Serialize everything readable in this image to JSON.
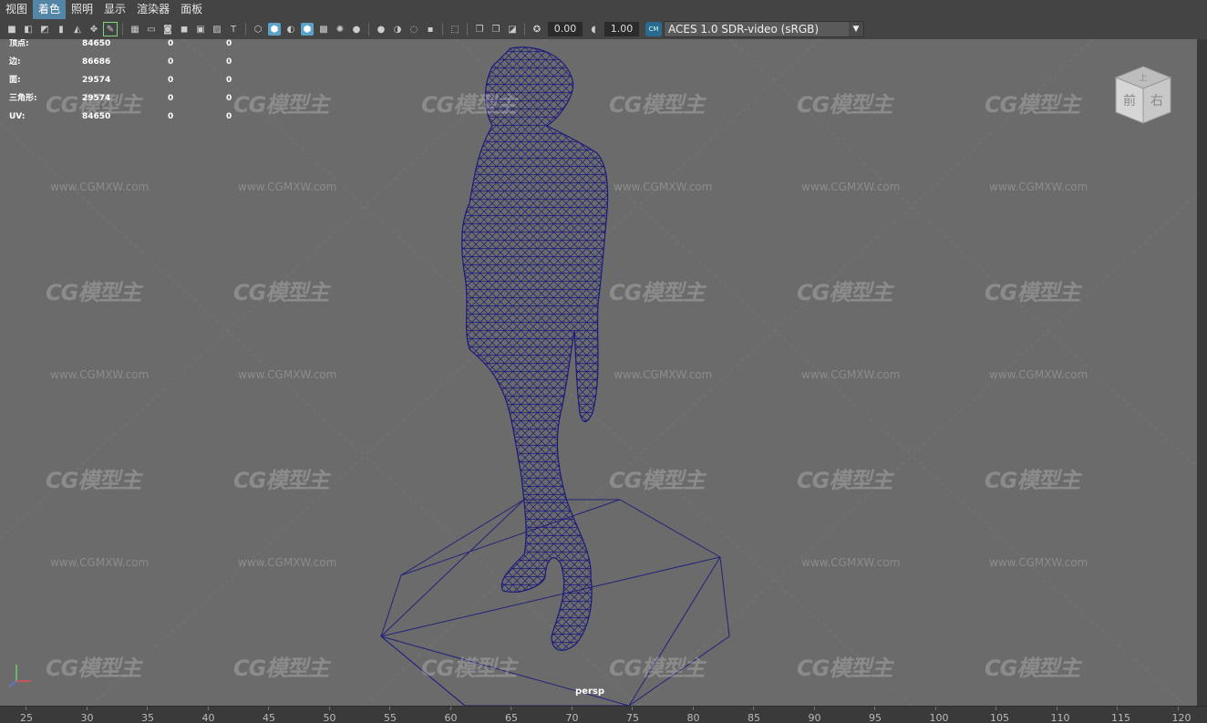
{
  "menubar": {
    "items": [
      {
        "label": "视图",
        "active": false
      },
      {
        "label": "着色",
        "active": true
      },
      {
        "label": "照明",
        "active": false
      },
      {
        "label": "显示",
        "active": false
      },
      {
        "label": "渲染器",
        "active": false
      },
      {
        "label": "面板",
        "active": false
      }
    ]
  },
  "toolbar": {
    "exposure_value": "0.00",
    "gamma_value": "1.00",
    "color_management": "ACES 1.0 SDR-video (sRGB)",
    "cm_badge": "CM"
  },
  "hud": {
    "rows": [
      {
        "label": "顶点:",
        "v1": "84650",
        "v2": "0",
        "v3": "0"
      },
      {
        "label": "边:",
        "v1": "86686",
        "v2": "0",
        "v3": "0"
      },
      {
        "label": "面:",
        "v1": "29574",
        "v2": "0",
        "v3": "0"
      },
      {
        "label": "三角形:",
        "v1": "29574",
        "v2": "0",
        "v3": "0"
      },
      {
        "label": "UV:",
        "v1": "84650",
        "v2": "0",
        "v3": "0"
      }
    ]
  },
  "viewcube": {
    "top": "上",
    "front": "前",
    "right": "右"
  },
  "viewport": {
    "camera_label": "persp",
    "background_color": "#6b6b6b",
    "wireframe_color": "#1a1a7a"
  },
  "watermark": {
    "logo": "CG模型主",
    "url": "www.CGMXW.com"
  },
  "timeline": {
    "ticks": [
      "25",
      "30",
      "35",
      "40",
      "45",
      "50",
      "55",
      "60",
      "65",
      "70",
      "75",
      "80",
      "85",
      "90",
      "95",
      "100",
      "105",
      "110",
      "115",
      "120"
    ]
  }
}
